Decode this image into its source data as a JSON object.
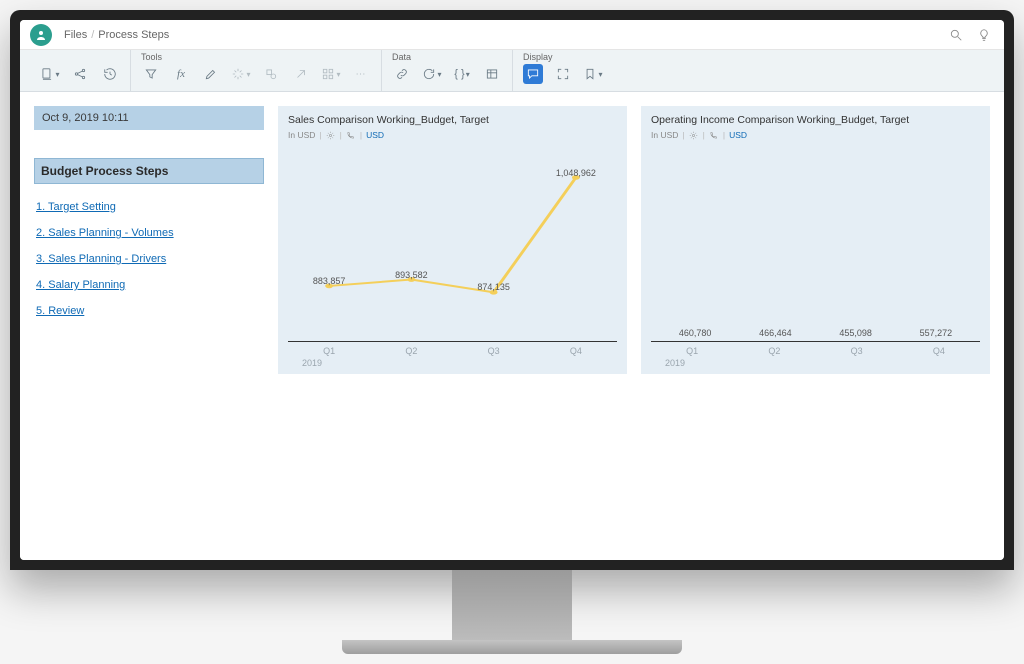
{
  "breadcrumb": {
    "root": "Files",
    "page": "Process Steps"
  },
  "toolbar": {
    "groups": {
      "file": {
        "label": ""
      },
      "tools": {
        "label": "Tools"
      },
      "data": {
        "label": "Data"
      },
      "display": {
        "label": "Display"
      }
    }
  },
  "sidebar": {
    "timestamp": "Oct 9, 2019   10:11",
    "header": "Budget Process Steps",
    "steps": [
      {
        "label": "1.  Target Setting"
      },
      {
        "label": "2.   Sales Planning - Volumes"
      },
      {
        "label": "3.   Sales Planning - Drivers"
      },
      {
        "label": "4.   Salary Planning"
      },
      {
        "label": "5.   Review"
      }
    ]
  },
  "chart1": {
    "title": "Sales Comparison Working_Budget, Target",
    "sub_prefix": "In USD",
    "sub_currency": "USD",
    "axis_year": "2019"
  },
  "chart2": {
    "title": "Operating Income Comparison Working_Budget, Target",
    "sub_prefix": "In USD",
    "sub_currency": "USD",
    "axis_year": "2019"
  },
  "chart_data": [
    {
      "type": "line",
      "title": "Sales Comparison Working_Budget, Target",
      "xlabel": "2019",
      "ylabel": "",
      "categories": [
        "Q1",
        "Q2",
        "Q3",
        "Q4"
      ],
      "values": [
        883857,
        893582,
        874135,
        1048962
      ],
      "ylim": [
        800000,
        1100000
      ]
    },
    {
      "type": "bar",
      "title": "Operating Income Comparison Working_Budget, Target",
      "xlabel": "2019",
      "ylabel": "",
      "categories": [
        "Q1",
        "Q2",
        "Q3",
        "Q4"
      ],
      "values": [
        460780,
        466464,
        455098,
        557272
      ],
      "ylim": [
        0,
        600000
      ]
    }
  ]
}
